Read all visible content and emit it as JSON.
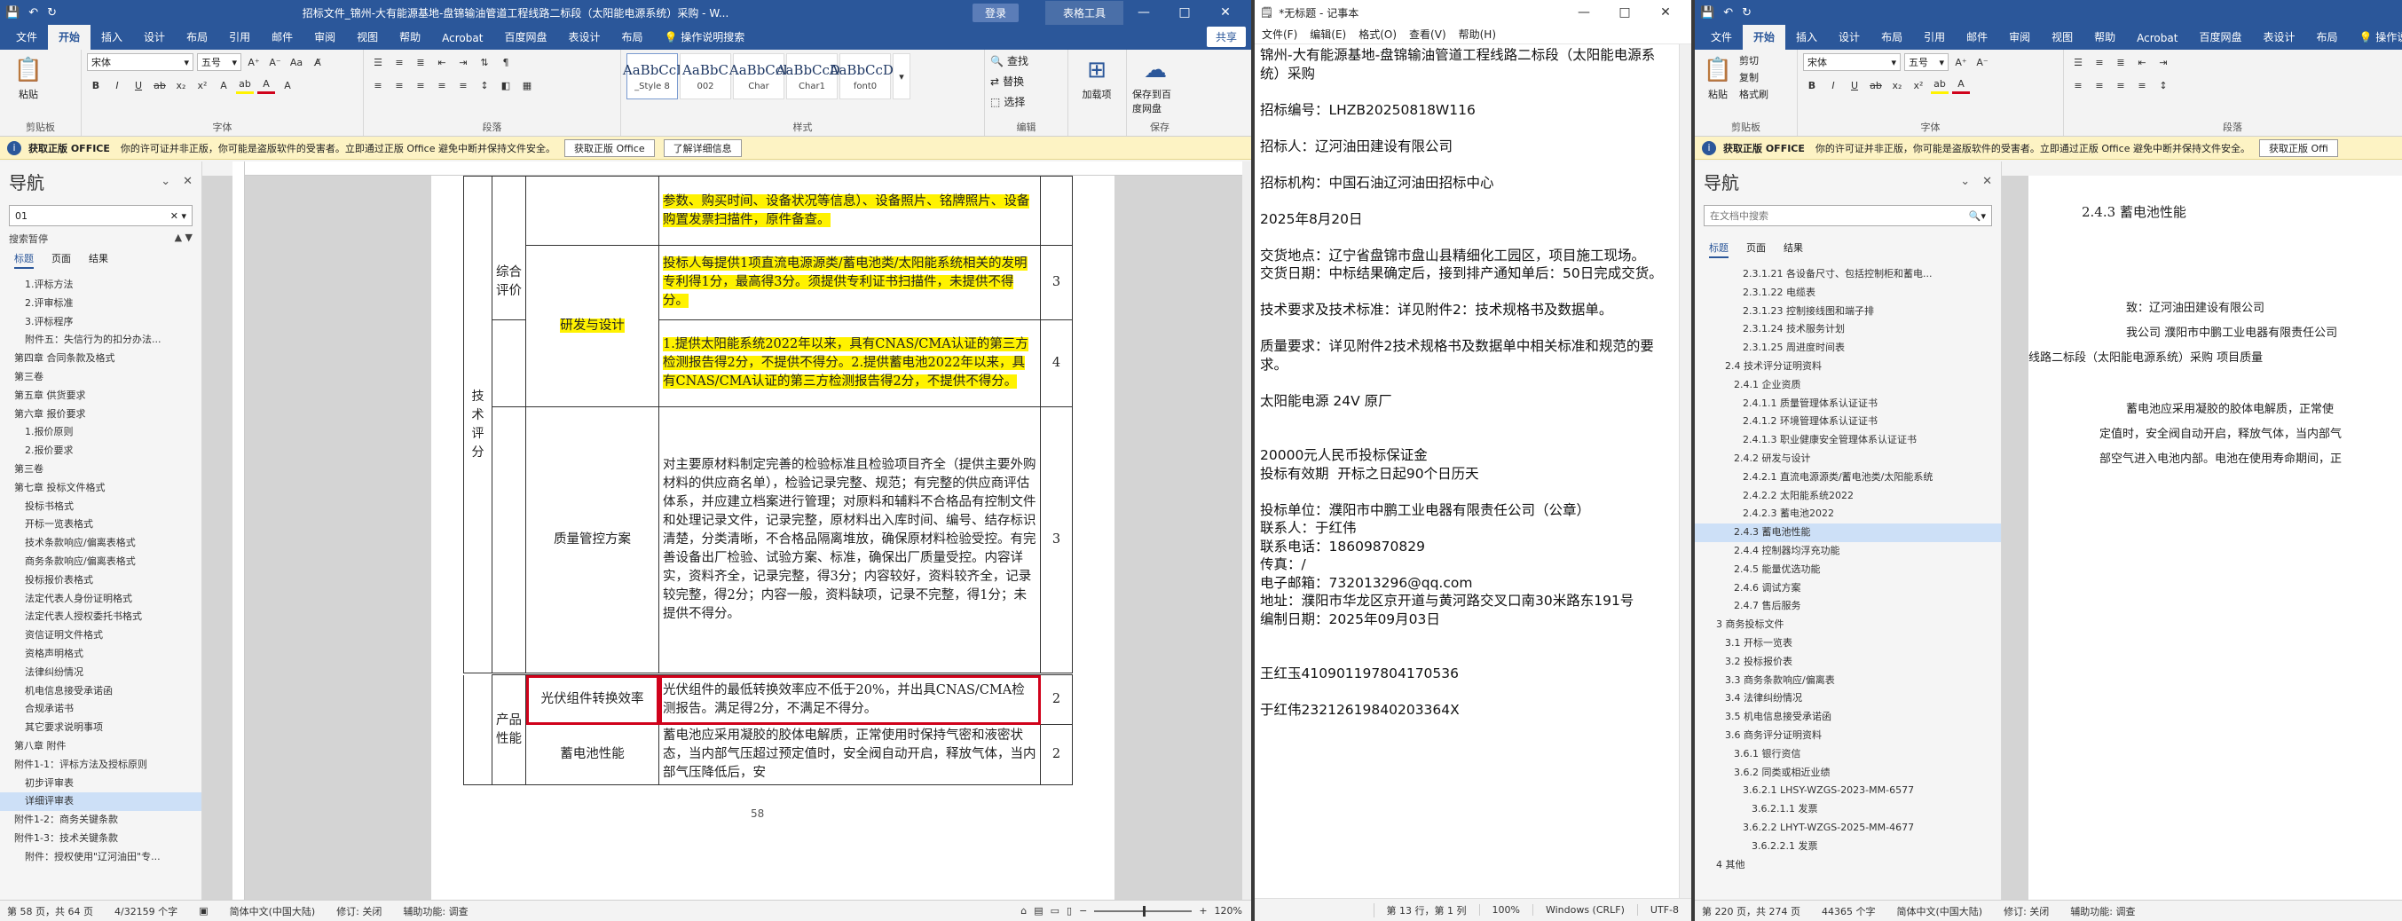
{
  "word1": {
    "title": "招标文件_锦州-大有能源基地-盘锦输油管道工程线路二标段（太阳能电源系统）采购 - W...",
    "login": "登录",
    "context_tab": "表格工具",
    "window_controls": [
      "—",
      "□",
      "✕"
    ],
    "menu": [
      "文件",
      "开始",
      "插入",
      "设计",
      "布局",
      "引用",
      "邮件",
      "审阅",
      "视图",
      "帮助",
      "Acrobat",
      "百度网盘",
      "表设计",
      "布局"
    ],
    "active_menu": "开始",
    "tell_me": "操作说明搜索",
    "share": "共享",
    "ribbon": {
      "paste": "粘贴",
      "clipboard_label": "剪贴板",
      "font_name": "宋体",
      "font_size": "五号",
      "font_label": "字体",
      "paragraph_label": "段落",
      "styles": [
        {
          "preview": "AaBbCcI",
          "name": "_Style 8"
        },
        {
          "preview": "AaBbC",
          "name": "002"
        },
        {
          "preview": "AaBbCcI",
          "name": "Char"
        },
        {
          "preview": "AaBbCcDc",
          "name": "Char1"
        },
        {
          "preview": "AaBbCcDc",
          "name": "font0"
        }
      ],
      "styles_label": "样式",
      "find": "查找",
      "replace": "替换",
      "select": "选择",
      "editing_label": "编辑",
      "load_item": "加载项",
      "save_baidu": "保存到百度网盘",
      "save_label": "保存"
    },
    "infobar": {
      "title": "获取正版 OFFICE",
      "text": "你的许可证并非正版，你可能是盗版软件的受害者。立即通过正版 Office 避免中断并保持文件安全。",
      "btn1": "获取正版 Office",
      "btn2": "了解详细信息"
    },
    "nav": {
      "title": "导航",
      "search_value": "01",
      "results": "搜索暂停",
      "tabs": [
        "标题",
        "页面",
        "结果"
      ],
      "items": [
        "2.评审标准",
        "3.评标程序",
        "附件五：失信行为的扣分办法...",
        "第四章 合同条款及格式",
        "第三卷",
        "第五章 供货要求",
        "第六章 报价要求",
        "1.报价原则",
        "2.报价要求",
        "第三卷",
        "第七章 投标文件格式",
        "投标书格式",
        "开标一览表格式",
        "技术条款响应/偏离表格式",
        "商务条款响应/偏离表格式",
        "投标报价表格式",
        "法定代表人身份证明格式",
        "法定代表人授权委托书格式",
        "资信证明文件格式",
        "资格声明格式",
        "法律纠纷情况",
        "机电信息接受承诺函",
        "合规承诺书",
        "其它要求说明事项",
        "第八章 附件",
        "附件1-1：评标方法及授标原则",
        "初步评审表",
        "详细评审表",
        "附件1-2：商务关键条款",
        "附件1-3：技术关键条款",
        "附件：授权使用\"辽河油田\"专..."
      ],
      "top_item": "1.评标方法",
      "selected": "详细评审表"
    },
    "table": {
      "row1_text": "参数、购买时间、设备状况等信息）、设备照片、铭牌照片、设备购置发票扫描件，原件备查。",
      "group_tech": "技术评分",
      "group_comp": "综合评价",
      "research_label": "研发与设计",
      "research_text1": "投标人每提供1项直流电源源类/蓄电池类/太阳能系统相关的发明专利得1分，最高得3分。须提供专利证书扫描件，未提供不得分。",
      "research_score1": "3",
      "research_text2": "1.提供太阳能系统2022年以来，具有CNAS/CMA认证的第三方检测报告得2分，不提供不得分。2.提供蓄电池2022年以来，具有CNAS/CMA认证的第三方检测报告得2分，不提供不得分。",
      "research_score2": "4",
      "quality_label": "质量管控方案",
      "quality_text": "对主要原材料制定完善的检验标准且检验项目齐全（提供主要外购材料的供应商名单），检验记录完整、规范；有完整的供应商评估体系，并应建立档案进行管理；对原料和辅料不合格品有控制文件和处理记录文件，记录完整，原材料出入库时间、编号、结存标识清楚，分类清晰，不合格品隔离堆放，确保原材料检验受控。有完善设备出厂检验、试验方案、标准，确保出厂质量受控。内容详实，资料齐全，记录完整，得3分；内容较好，资料较齐全，记录较完整，得2分；内容一般，资料缺项，记录不完整，得1分；未提供不得分。",
      "quality_score": "3",
      "group_product": "产品性能",
      "pv_label": "光伏组件转换效率",
      "pv_text": "光伏组件的最低转换效率应不低于20%，并出具CNAS/CMA检测报告。满足得2分，不满足不得分。",
      "pv_score": "2",
      "battery_label": "蓄电池性能",
      "battery_text": "蓄电池应采用凝胶的胶体电解质，正常使用时保持气密和液密状态，当内部气压超过预定值时，安全阀自动开启，释放气体，当内部气压降低后，安",
      "battery_score": "2",
      "page_number": "58"
    },
    "status": {
      "page": "第 58 页，共 64 页",
      "words": "4/32159 个字",
      "lang": "简体中文(中国大陆)",
      "track": "修订: 关闭",
      "access": "辅助功能: 调查",
      "zoom": "120%"
    }
  },
  "notepad": {
    "title": "*无标题 - 记事本",
    "menu": [
      "文件(F)",
      "编辑(E)",
      "格式(O)",
      "查看(V)",
      "帮助(H)"
    ],
    "content": "锦州-大有能源基地-盘锦输油管道工程线路二标段（太阳能电源系统）采购\n\n招标编号：LHZB20250818W116\n\n招标人：辽河油田建设有限公司\n\n招标机构：中国石油辽河油田招标中心\n\n2025年8月20日\n\n交货地点：辽宁省盘锦市盘山县精细化工园区，项目施工现场。\n交货日期：中标结果确定后，接到排产通知单后：50日完成交货。\n\n技术要求及技术标准：详见附件2：技术规格书及数据单。\n\n质量要求：详见附件2技术规格书及数据单中相关标准和规范的要求。\n\n太阳能电源 24V 原厂\n\n\n20000元人民币投标保证金\n投标有效期  开标之日起90个日历天\n\n投标单位：濮阳市中鹏工业电器有限责任公司（公章）\n联系人：于红伟\n联系电话：18609870829\n传真：/\n电子邮箱：732013296@qq.com\n地址：濮阳市华龙区京开道与黄河路交叉口南30米路东191号\n编制日期：2025年09月03日\n\n\n王红玉410901197804170536\n\n于红伟23212619840203364X",
    "status": [
      "第 13 行，第 1 列",
      "100%",
      "Windows (CRLF)",
      "UTF-8"
    ]
  },
  "word2": {
    "menu": [
      "文件",
      "开始",
      "插入",
      "设计",
      "布局",
      "引用",
      "邮件",
      "审阅",
      "视图",
      "帮助",
      "Acrobat",
      "百度网盘",
      "表设计",
      "布局"
    ],
    "tell_me": "操作说明搜索",
    "ribbon": {
      "cut": "剪切",
      "copy": "复制",
      "paste": "粘贴",
      "format_painter": "格式刷",
      "clipboard_label": "剪贴板",
      "font_name": "宋体",
      "font_size": "五号",
      "font_label": "字体",
      "paragraph_label": "段落"
    },
    "infobar": {
      "title": "获取正版 OFFICE",
      "text": "你的许可证并非正版，你可能是盗版软件的受害者。立即通过正版 Office 避免中断并保持文件安全。",
      "btn1": "获取正版 Offi"
    },
    "nav": {
      "title": "导航",
      "search_placeholder": "在文档中搜索",
      "tabs": [
        "标题",
        "页面",
        "结果"
      ],
      "items": [
        "2.3.1.21 各设备尺寸、包括控制柜和蓄电...",
        "2.3.1.22 电缆表",
        "2.3.1.23 控制接线图和端子排",
        "2.3.1.24 技术服务计划",
        "2.3.1.25 周进度时间表",
        "2.4 技术评分证明资料",
        "2.4.1 企业资质",
        "2.4.1.1 质量管理体系认证证书",
        "2.4.1.2 环境管理体系认证证书",
        "2.4.1.3 职业健康安全管理体系认证证书",
        "2.4.2 研发与设计",
        "2.4.2.1 直流电源源类/蓄电池类/太阳能系统",
        "2.4.2.2 太阳能系统2022",
        "2.4.2.3 蓄电池2022",
        "2.4.3 蓄电池性能",
        "2.4.4 控制器均浮充功能",
        "2.4.5 能量优选功能",
        "2.4.6 调试方案",
        "2.4.7 售后服务",
        "3 商务投标文件",
        "3.1 开标一览表",
        "3.2 投标报价表",
        "3.3 商务条款响应/偏离表",
        "3.4 法律纠纷情况",
        "3.5 机电信息接受承诺函",
        "3.6 商务评分证明资料",
        "3.6.1 银行资信",
        "3.6.2 同类或相近业绩",
        "3.6.2.1 LHSY-WZGS-2023-MM-6577",
        "3.6.2.1.1 发票",
        "3.6.2.2 LHYT-WZGS-2025-MM-4677",
        "3.6.2.2.1 发票",
        "4 其他"
      ],
      "selected": "2.4.3 蓄电池性能"
    },
    "doc": {
      "heading": "2.4.3  蓄电池性能",
      "line1": "致：辽河油田建设有限公司",
      "line2": "我公司 濮阳市中鹏工业电器有限责任公司",
      "line3": "线路二标段（太阳能电源系统）采购 项目质量",
      "line4": "蓄电池应采用凝胶的胶体电解质，正常使",
      "line5": "定值时，安全阀自动开启，释放气体，当内部气",
      "line6": "部空气进入电池内部。电池在使用寿命期间，正"
    },
    "status": {
      "page": "第 220 页，共 274 页",
      "words": "44365 个字",
      "lang": "简体中文(中国大陆)",
      "track": "修订: 关闭",
      "access": "辅助功能: 调查"
    }
  },
  "colors": {
    "word_blue": "#2b579a",
    "highlight": "#fff200",
    "red_box": "#d0021b",
    "info_bg": "#fdf3c4"
  }
}
